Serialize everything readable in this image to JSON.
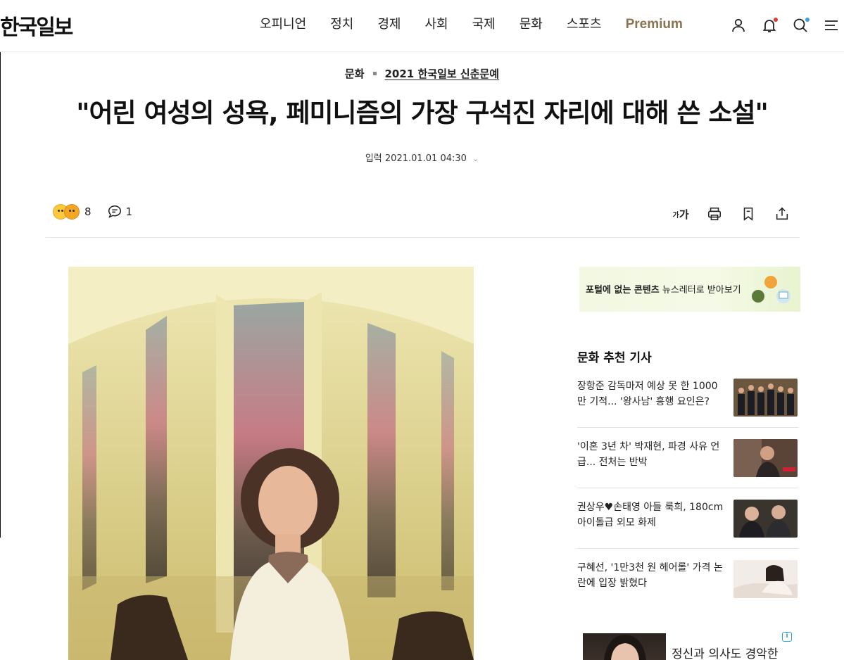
{
  "header": {
    "logo": "한국일보",
    "nav": [
      "오피니언",
      "정치",
      "경제",
      "사회",
      "국제",
      "문화",
      "스포츠"
    ],
    "premium": "Premium",
    "icons": [
      "user-icon",
      "bell-icon",
      "search-icon",
      "menu-icon"
    ]
  },
  "article": {
    "category": "문화",
    "series": "2021 한국일보 신춘문예",
    "headline": "\"어린 여성의 성욕, 페미니즘의 가장 구석진 자리에 대해 쓴 소설\"",
    "date_label": "입력 2021.01.01 04:30"
  },
  "toolbar": {
    "reaction_count": "8",
    "comment_count": "1",
    "font_small": "가",
    "font_large": "가",
    "tools": [
      "font-size-icon",
      "print-icon",
      "bookmark-icon",
      "share-icon"
    ]
  },
  "sidebar": {
    "banner": {
      "bold": "포털에 없는 콘텐츠",
      "text": "뉴스레터로 받아보기"
    },
    "recommend_title": "문화 추천 기사",
    "recommend": [
      {
        "title": "장항준 감독마저 예상 못 한 1000만 기적... '왕사남' 흥행 요인은?"
      },
      {
        "title": "'이혼 3년 차' 박재현, 파경 사유 언급... 전처는 반박"
      },
      {
        "title": "권상우♥손태영 아들 룩희, 180cm 아이돌급 외모 화제"
      },
      {
        "title": "구혜선, '1만3천 원 헤어롤' 가격 논란에 입장 밝혔다"
      }
    ]
  },
  "ad": {
    "text": "정신과 의사도 경악한",
    "badge": "i"
  },
  "colors": {
    "premium": "#8c7452",
    "notification_dot": "#e03a2f",
    "search_dot": "#3aa0e0",
    "banner_bg": "#f2f8e2"
  }
}
